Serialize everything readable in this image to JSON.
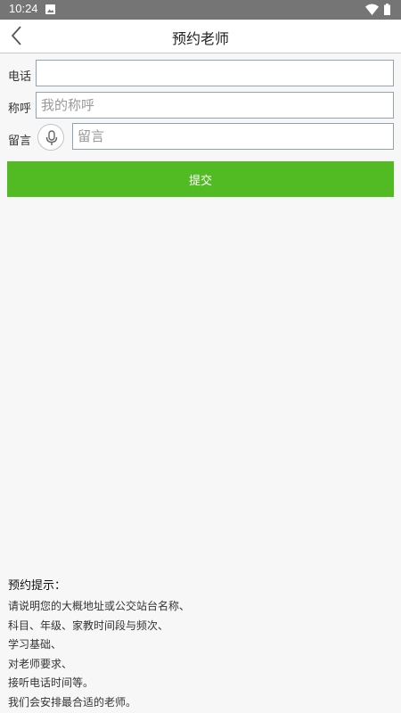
{
  "status_bar": {
    "time": "10:24",
    "icons": [
      "image-icon",
      "wifi-icon",
      "battery-icon"
    ]
  },
  "header": {
    "title": "预约老师",
    "back_icon": "chevron-left-icon"
  },
  "form": {
    "phone": {
      "label": "电话",
      "value": "",
      "placeholder": ""
    },
    "name": {
      "label": "称呼",
      "value": "",
      "placeholder": "我的称呼"
    },
    "message": {
      "label": "留言",
      "value": "",
      "placeholder": "留言",
      "mic_icon": "microphone-icon"
    },
    "submit_label": "提交"
  },
  "tips": {
    "title": "预约提示：",
    "lines": [
      "请说明您的大概地址或公交站台名称、",
      "科目、年级、家教时间段与频次、",
      "学习基础、",
      "对老师要求、",
      "接听电话时间等。",
      "我们会安排最合适的老师。"
    ]
  },
  "colors": {
    "status_bar": "#757575",
    "submit_green": "#52bb23",
    "input_border": "#8fa3b0",
    "background": "#f7f7f7"
  }
}
